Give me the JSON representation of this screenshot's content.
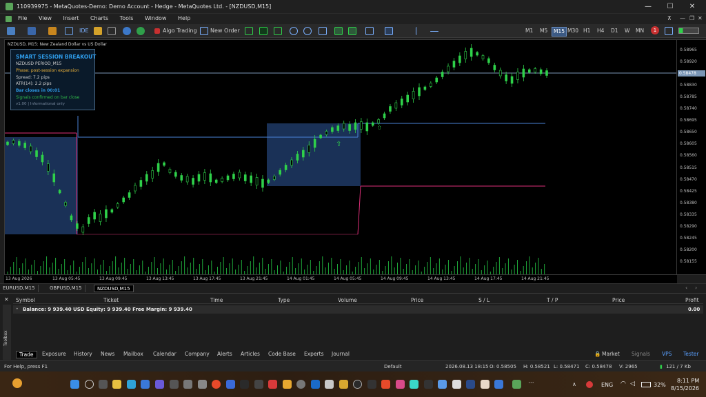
{
  "window": {
    "title": "110939975 - MetaQuotes-Demo: Demo Account - Hedge - MetaQuotes Ltd. - [NZDUSD,M15]"
  },
  "menu": [
    "File",
    "View",
    "Insert",
    "Charts",
    "Tools",
    "Window",
    "Help"
  ],
  "toolbar": {
    "algo_trading": "Algo Trading",
    "new_order": "New Order",
    "ide": "IDE",
    "timeframes": [
      "M1",
      "M5",
      "M15",
      "M30",
      "H1",
      "H4",
      "D1",
      "W",
      "MN"
    ],
    "active_timeframe": "M15",
    "notification_count": "1"
  },
  "chart": {
    "title": "NZDUSD, M15:  New Zealand Dollar vs US Dollar",
    "current_price": "0.58478",
    "price_ticks": [
      "0.58965",
      "0.58920",
      "0.58875",
      "0.58830",
      "0.58785",
      "0.58740",
      "0.58695",
      "0.58650",
      "0.58605",
      "0.58560",
      "0.58515",
      "0.58470",
      "0.58425",
      "0.58380",
      "0.58335",
      "0.58290",
      "0.58245",
      "0.58200",
      "0.58155"
    ],
    "time_ticks": [
      "13 Aug 2026",
      "13 Aug 05:45",
      "13 Aug 09:45",
      "13 Aug 13:45",
      "13 Aug 17:45",
      "13 Aug 21:45",
      "14 Aug 01:45",
      "14 Aug 05:45",
      "14 Aug 09:45",
      "14 Aug 13:45",
      "14 Aug 17:45",
      "14 Aug 21:45"
    ]
  },
  "panel": {
    "title": "SMART SESSION BREAKOUT",
    "symbol": "NZDUSD  PERIOD_M15",
    "phase": "Phase: post-session expansion",
    "spread": "Spread: 7.2 pips",
    "atr": "ATR(14): 2.2 pips",
    "bar_close": "Bar closes in 00:01",
    "signals": "Signals confirmed on bar close",
    "version": "v1.00  |  Informational only",
    "colors": {
      "title": "#2e9be8",
      "phase": "#e8b03a",
      "bar_close": "#2e9be8",
      "signals": "#2fb84a"
    }
  },
  "chart_tabs": [
    "EURUSD,M15",
    "GBPUSD,M15",
    "NZDUSD,M15"
  ],
  "active_chart_tab": "NZDUSD,M15",
  "toolbox": {
    "columns": [
      "Symbol",
      "Ticket",
      "Time",
      "Type",
      "Volume",
      "Price",
      "S / L",
      "T / P",
      "Price",
      "Profit"
    ],
    "balance_row": "Balance: 9 939.40 USD  Equity: 9 939.40  Free Margin: 9 939.40",
    "balance_profit": "0.00",
    "tabs": [
      "Trade",
      "Exposure",
      "History",
      "News",
      "Mailbox",
      "Calendar",
      "Company",
      "Alerts",
      "Articles",
      "Code Base",
      "Experts",
      "Journal"
    ],
    "active_tab": "Trade",
    "right_items": [
      "Market",
      "Signals",
      "VPS",
      "Tester"
    ],
    "side_label": "Toolbox"
  },
  "status": {
    "help": "For Help, press F1",
    "profile": "Default",
    "datetime": "2026.08.13 18:15",
    "open": "O: 0.58505",
    "high": "H: 0.58521",
    "low": "L: 0.58471",
    "close": "C: 0.58478",
    "volume": "V: 2965",
    "traffic": "121 / 7 Kb"
  },
  "taskbar": {
    "language": "ENG",
    "battery": "32%",
    "time": "8:11 PM",
    "date": "8/15/2026"
  },
  "colors": {
    "bull": "#2fd14a",
    "session_box": "#1f3a66",
    "session_line": "#4a84d8",
    "range_low_line": "#e0307a"
  }
}
